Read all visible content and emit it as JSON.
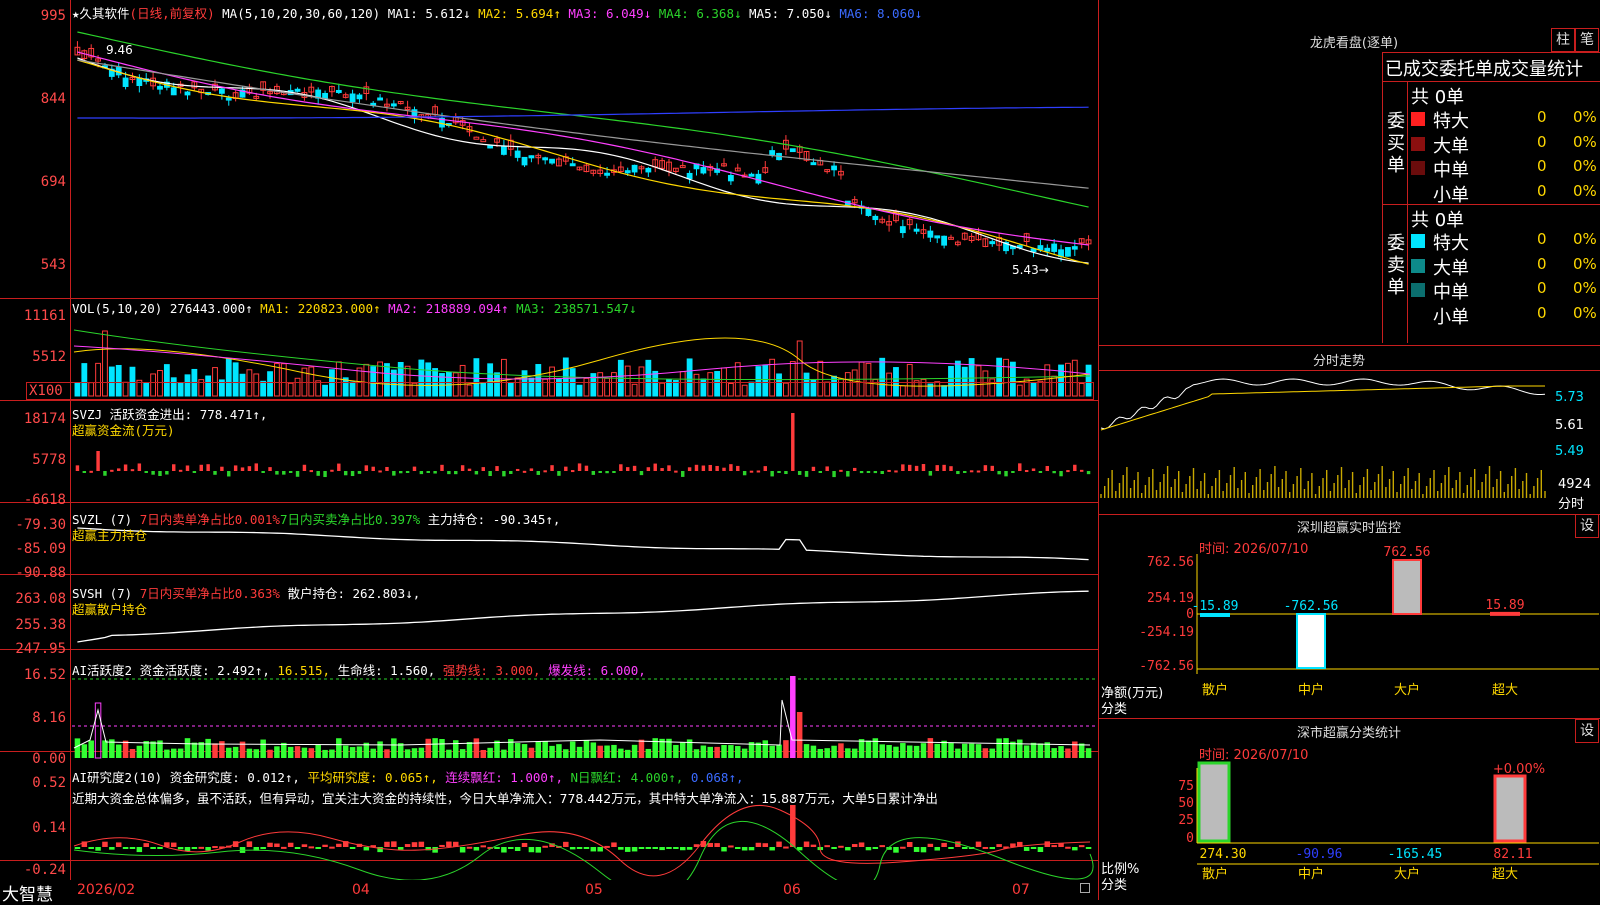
{
  "colors": {
    "up": "#ff3b3b",
    "down": "#00e5ff",
    "ma_white": "#ffffff",
    "ma_yellow": "#ffd800",
    "ma_magenta": "#ff40ff",
    "ma_green": "#2bd42b",
    "ma_gray": "#999999",
    "ma_blue": "#2f3fff",
    "grid_red": "#c81e1e"
  },
  "main": {
    "stock": "久其软件",
    "star": "★",
    "mode": "(日线,前复权)",
    "ma_label": "MA(5,10,20,30,60,120)",
    "ma1": "MA1: 5.612↓",
    "ma2": "MA2: 5.694↑",
    "ma3": "MA3: 6.049↓",
    "ma4": "MA4: 6.368↓",
    "ma5": "MA5: 7.050↓",
    "ma6": "MA6: 8.060↓",
    "y_labels": [
      "995",
      "844",
      "694",
      "543"
    ],
    "high_note": "9.46",
    "low_note": "5.43→"
  },
  "vol": {
    "label": "VOL(5,10,20)",
    "val": "276443.000↑",
    "ma1": "MA1: 220823.000↑",
    "ma2": "MA2: 218889.094↑",
    "ma3": "MA3: 238571.547↓",
    "y_labels": [
      "11161",
      "5512"
    ],
    "unit": "X100"
  },
  "svzj": {
    "label": "SVZJ",
    "text": "活跃资金进出: 778.471↑,",
    "sub": "超赢资金流(万元)",
    "y_labels": [
      "18174",
      "5778",
      "-6618"
    ]
  },
  "svzl": {
    "label": "SVZL (7)",
    "t1": "7日内卖单净占比0.001%",
    "t2": "7日内买卖净占比0.397%",
    "t3": "主力持仓: -90.345↑,",
    "sub": "超赢主力持仓",
    "y_labels": [
      "-79.30",
      "-85.09",
      "-90.88"
    ]
  },
  "svsh": {
    "label": "SVSH (7)",
    "t1": "7日内买单净占比0.363%",
    "t2": "散户持仓: 262.803↓,",
    "sub": "超赢散户持仓",
    "y_labels": [
      "263.08",
      "255.38",
      "247.95"
    ]
  },
  "ai1": {
    "label": "AI活跃度2",
    "t1": "资金活跃度: 2.492↑,",
    "t2": "16.515,",
    "t3": "生命线: 1.560,",
    "t4": "强势线: 3.000,",
    "t5": "爆发线: 6.000,",
    "y_labels": [
      "16.52",
      "8.16",
      "0.00"
    ]
  },
  "ai2": {
    "label": "AI研究度2(10)",
    "t1": "资金研究度: 0.012↑,",
    "t2": "平均研究度: 0.065↑,",
    "t3": "连续飘红: 1.000↑,",
    "t4": "N日飘红: 4.000↑,",
    "t5": "0.068↑,",
    "comment": "近期大资金总体偏多，虽不活跃，但有异动，宜关注大资金的持续性，今日大单净流入：778.442万元，其中特大单净流入：15.887万元，大单5日累计净出",
    "y_labels": [
      "0.52",
      "0.14",
      "-0.24"
    ]
  },
  "xaxis": {
    "brand": "大智慧",
    "dates": [
      "2026/02",
      "04",
      "05",
      "06",
      "07"
    ]
  },
  "lhb": {
    "title": "龙虎看盘(逐单)",
    "btn1": "柱",
    "btn2": "笔",
    "header": "已成交委托单成交量统计",
    "buy_label": "委买单",
    "sell_label": "委卖单",
    "buy_total": "共 0单",
    "sell_total": "共 0单",
    "buy_rows": [
      {
        "name": "特大",
        "count": "0",
        "pct": "0%",
        "color": "#ff2020"
      },
      {
        "name": "大单",
        "count": "0",
        "pct": "0%",
        "color": "#8b0f0f"
      },
      {
        "name": "中单",
        "count": "0",
        "pct": "0%",
        "color": "#6a0c0c"
      },
      {
        "name": "小单",
        "count": "0",
        "pct": "0%",
        "color": "#000000"
      }
    ],
    "sell_rows": [
      {
        "name": "特大",
        "count": "0",
        "pct": "0%",
        "color": "#00e5ff"
      },
      {
        "name": "大单",
        "count": "0",
        "pct": "0%",
        "color": "#0d8a8a"
      },
      {
        "name": "中单",
        "count": "0",
        "pct": "0%",
        "color": "#0b6f6f"
      },
      {
        "name": "小单",
        "count": "0",
        "pct": "0%",
        "color": "#000000"
      }
    ]
  },
  "fenshi": {
    "title": "分时走势",
    "y_labels": [
      "5.73",
      "5.61",
      "5.49"
    ],
    "vol_label": "4924",
    "vol_unit": "分时"
  },
  "szjk": {
    "title": "深圳超赢实时监控",
    "btn": "设",
    "time": "时间: 2026/07/10",
    "y_labels": [
      "762.56",
      "254.19",
      "0",
      "-254.19",
      "-762.56"
    ],
    "axis_name": "净额(万元)",
    "axis_cat": "分类",
    "categories": [
      "散户",
      "中户",
      "大户",
      "超大"
    ],
    "values": [
      -15.89,
      -762.56,
      762.56,
      15.89
    ],
    "value_labels": [
      "-15.89",
      "-762.56",
      "762.56",
      "15.89"
    ]
  },
  "sfl": {
    "title": "深市超赢分类统计",
    "btn": "设",
    "time": "时间: 2026/07/10",
    "y_labels": [
      "75",
      "50",
      "25",
      "0"
    ],
    "axis_name": "比例%",
    "axis_cat": "分类",
    "categories": [
      "散户",
      "中户",
      "大户",
      "超大"
    ],
    "values": [
      "274.30",
      "-90.96",
      "-165.45",
      "82.11"
    ],
    "top_note": "+0.00%"
  },
  "chart_data": {
    "type": "bar",
    "title": "深圳超赢实时监控",
    "categories": [
      "散户",
      "中户",
      "大户",
      "超大"
    ],
    "values": [
      -15.89,
      -762.56,
      762.56,
      15.89
    ],
    "ylabel": "净额(万元)",
    "ylim": [
      -762.56,
      762.56
    ]
  }
}
